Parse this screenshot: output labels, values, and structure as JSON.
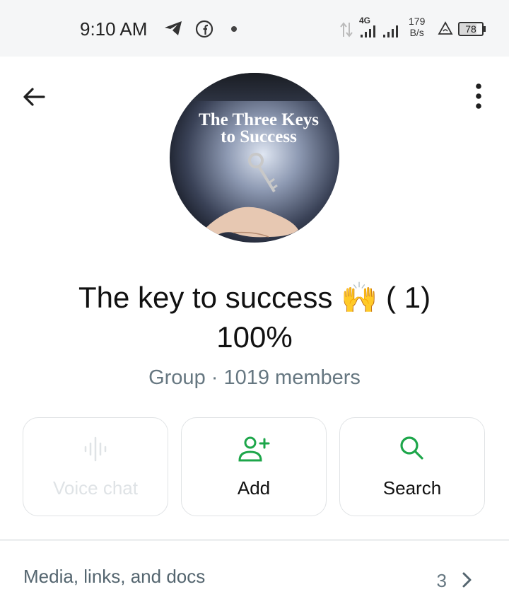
{
  "status_bar": {
    "time": "9:10 AM",
    "network_type": "4G",
    "speed_value": "179",
    "speed_unit": "B/s",
    "battery": "78",
    "battery_level_percent": 78,
    "icons": [
      "telegram-icon",
      "facebook-icon",
      "notification-dot",
      "data-arrows-icon",
      "signal-icon",
      "alert-icon",
      "battery-icon"
    ]
  },
  "header": {
    "back_icon": "arrow-left-icon",
    "menu_icon": "more-vertical-icon"
  },
  "avatar": {
    "text_line1": "The Three Keys",
    "text_line2": "to Success"
  },
  "group": {
    "title_line1": "The key to success 🙌 ( 1)",
    "title_line2": "100%",
    "subtitle": "Group · 1019 members"
  },
  "actions": [
    {
      "label": "Voice chat",
      "icon": "voice-chat-icon",
      "enabled": false
    },
    {
      "label": "Add",
      "icon": "add-person-icon",
      "enabled": true
    },
    {
      "label": "Search",
      "icon": "search-icon",
      "enabled": true
    }
  ],
  "media": {
    "label": "Media, links, and docs",
    "count": "3"
  },
  "colors": {
    "accent": "#1da64a",
    "muted_text": "#667781",
    "status_bar_bg": "#f5f6f7"
  }
}
